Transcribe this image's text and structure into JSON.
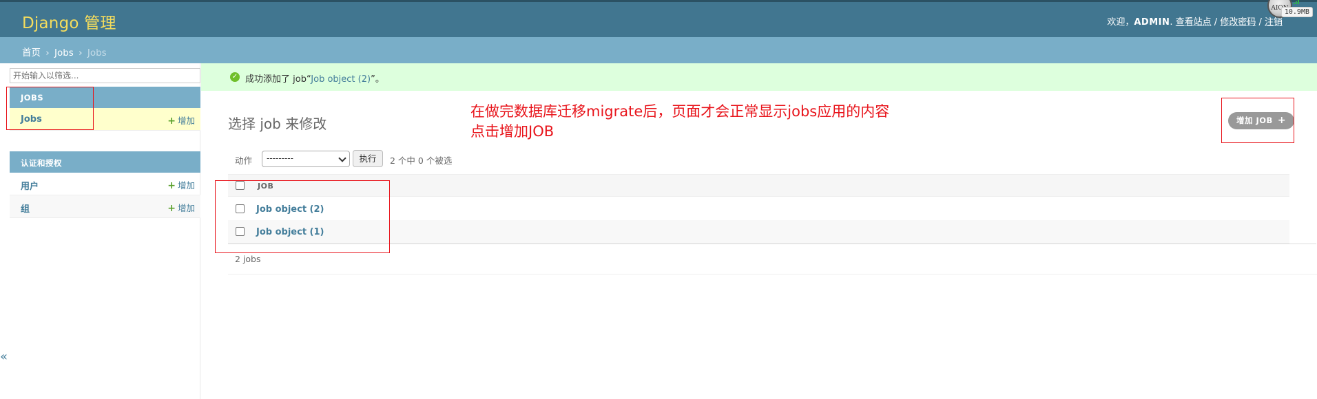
{
  "header": {
    "brand": "Django 管理",
    "welcome": "欢迎，",
    "username": "ADMIN",
    "view_site": "查看站点",
    "change_password": "修改密码",
    "logout": "注销",
    "sep": " / ",
    "avatar_text": "AION",
    "mem_badge": "10.9MB"
  },
  "breadcrumbs": {
    "home": "首页",
    "app": "Jobs",
    "current": "Jobs",
    "sep": "›"
  },
  "sidebar": {
    "filter_placeholder": "开始输入以筛选...",
    "modules": [
      {
        "caption": "JOBS",
        "rows": [
          {
            "label": "Jobs",
            "add": "增加"
          }
        ]
      },
      {
        "caption": "认证和授权",
        "rows": [
          {
            "label": "用户",
            "add": "增加"
          },
          {
            "label": "组",
            "add": "增加"
          }
        ]
      }
    ],
    "toggle": "«"
  },
  "message": {
    "prefix": "成功添加了 job“",
    "link": "Job object (2)",
    "suffix": "”。"
  },
  "content": {
    "title": "选择 job 来修改",
    "add_button": "增加 JOB",
    "add_button_icon": "+",
    "annotation_line1": "在做完数据库迁移migrate后，页面才会正常显示jobs应用的内容",
    "annotation_line2": "点击增加JOB"
  },
  "actions": {
    "label": "动作",
    "selected_option": "---------",
    "go_button": "执行",
    "counter": "2 个中 0 个被选"
  },
  "table": {
    "column": "JOB",
    "rows": [
      "Job object (2)",
      "Job object (1)"
    ]
  },
  "paginator": "2 jobs",
  "colors": {
    "header": "#417690",
    "breadcrumbs": "#79aec8",
    "brand": "#f5dd5d",
    "link": "#447e9b",
    "annotation": "#e8141b",
    "success": "#ddffdd"
  }
}
